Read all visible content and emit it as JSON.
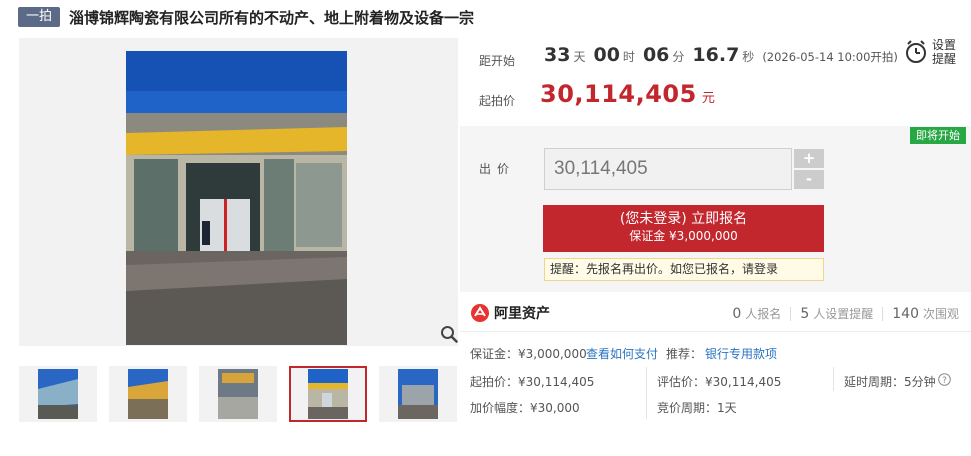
{
  "header": {
    "badge": "一拍",
    "title": "淄博锦辉陶瓷有限公司所有的不动产、地上附着物及设备一宗"
  },
  "countdown": {
    "label": "距开始",
    "days": "33",
    "days_unit": "天",
    "hours": "00",
    "hours_unit": "时",
    "minutes": "06",
    "minutes_unit": "分",
    "seconds": "16.7",
    "seconds_unit": "秒",
    "note": "(2026-05-14 10:00开拍)"
  },
  "start_price": {
    "label": "起拍价",
    "value": "30,114,405",
    "unit": "元"
  },
  "remind": {
    "label_line1": "设置",
    "label_line2": "提醒"
  },
  "status_tag": "即将开始",
  "bid": {
    "label": "出价",
    "value": "30,114,405",
    "plus": "+",
    "minus": "-",
    "signup_main": "(您未登录) 立即报名",
    "signup_sub": "保证金 ¥3,000,000",
    "tip": "提醒：先报名再出价。如您已报名，请登录"
  },
  "org": {
    "name": "阿里资产",
    "signed_count": "0",
    "signed_label": "人报名",
    "remind_count": "5",
    "remind_label": "人设置提醒",
    "view_count": "140",
    "view_label": "次围观"
  },
  "details": {
    "deposit": "保证金：¥3,000,000",
    "how_to_pay": "查看如何支付",
    "recommend_label": "推荐：",
    "recommend_link": "银行专用款项",
    "start_price": "起拍价：¥30,114,405",
    "appraisal": "评估价：¥30,114,405",
    "delay": "延时周期：5分钟",
    "increment": "加价幅度：¥30,000",
    "bid_period": "竞价周期：1天"
  },
  "colors": {
    "accent_red": "#c1272d",
    "badge_bg": "#5b6a87",
    "status_green": "#28a745",
    "link_blue": "#2a74c2"
  },
  "icons": [
    "zoom-icon",
    "clock-remind-icon",
    "help-icon",
    "alibaba-asset-logo"
  ]
}
